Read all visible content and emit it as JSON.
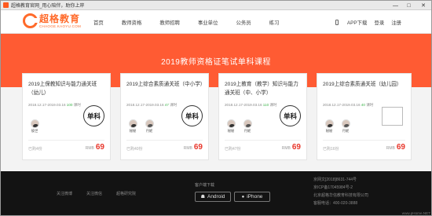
{
  "window": {
    "title": "超格教育官网_用心陪伴，助你上岸",
    "min": "—",
    "max": "□",
    "close": "✕"
  },
  "nav": {
    "logo_zh": "超格教育",
    "logo_en": "CHAOGE.KAOYU.COM",
    "menu": [
      "首页",
      "教师资格",
      "教师招聘",
      "事业单位",
      "公务员",
      "练习"
    ],
    "app_download": "APP下载",
    "login": "登录",
    "register": "注册"
  },
  "banner": {
    "title": "2019教师资格证笔试单科课程"
  },
  "cards": [
    {
      "title": "2019上保教知识与能力通关班（幼儿）",
      "date": "2018.12.17-2019.03.16",
      "hours": "100",
      "hours_unit": "课时",
      "badge": "单科",
      "teachers": [
        "彼世"
      ],
      "enrolled": "已购4份",
      "currency": "RMB",
      "price": "69"
    },
    {
      "title": "2019上综合素质通关班（中小学）",
      "date": "2018.12.17-2019.03.16",
      "hours": "47",
      "hours_unit": "课时",
      "badge": "单科",
      "teachers": [
        "秘秘",
        "丹妮"
      ],
      "enrolled": "已购40份",
      "currency": "RMB",
      "price": "69"
    },
    {
      "title": "2019上教育（教学）知识与能力通关班（中、小学）",
      "date": "2018.12.17-2019.03.16",
      "hours": "110",
      "hours_unit": "课时",
      "badge": "单科",
      "teachers": [
        "秘秘",
        "丹妮"
      ],
      "enrolled": "已购47份",
      "currency": "RMB",
      "price": "69"
    },
    {
      "title": "2019上综合素质通关班（幼儿园）",
      "date": "2018.12.17-2019.03.16",
      "hours": "40",
      "hours_unit": "课时",
      "badge": "",
      "teachers": [
        "秘秘",
        "丹妮"
      ],
      "enrolled": "已购16份",
      "currency": "RMB",
      "price": "69"
    }
  ],
  "footer": {
    "links": [
      "关注微博",
      "关注微信",
      "超格研究院"
    ],
    "download_label": "客户端下载",
    "android": "Android",
    "iphone": "iPhone",
    "info": [
      "京网文[2018]8631-744号",
      "京ICP备17045984号-2",
      "北京超格华信教育科技有限公司",
      "客服电话：400-020-3888"
    ],
    "watermark": "www.pHome.NET"
  }
}
